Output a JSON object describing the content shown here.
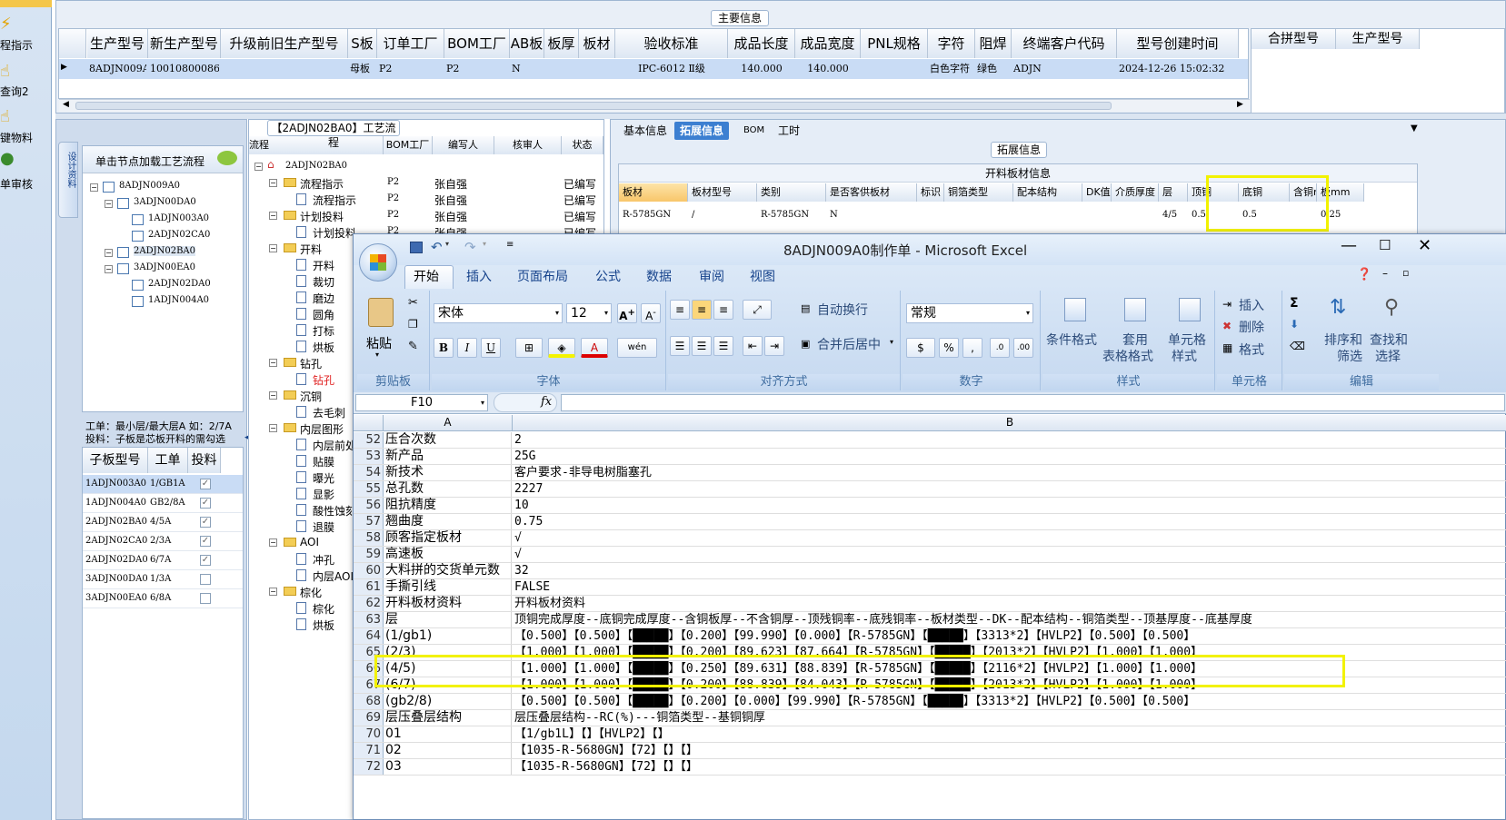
{
  "left_toolbar": {
    "items": [
      "程指示",
      "查询2",
      "键物料",
      "单审核"
    ]
  },
  "main_info": {
    "group_title": "主要信息",
    "headers": [
      "生产型号",
      "新生产型号",
      "升级前旧生产型号",
      "S板",
      "订单工厂",
      "BOM工厂",
      "AB板",
      "板厚",
      "板材",
      "验收标准",
      "成品长度",
      "成品宽度",
      "PNL规格",
      "字符",
      "阻焊",
      "终端客户代码",
      "型号创建时间"
    ],
    "row": [
      "8ADJN009A0",
      "10010800086888",
      "",
      "母板",
      "P2",
      "P2",
      "N",
      "",
      "",
      "IPC-6012 Ⅱ级",
      "140.000",
      "140.000",
      "",
      "白色字符",
      "绿色",
      "ADJN",
      "2024-12-26 15:02:32"
    ],
    "side_headers": [
      "合拼型号",
      "生产型号"
    ]
  },
  "process": {
    "group_title": "【2ADJN02BA0】工艺流程",
    "side_tab": "设计资料",
    "tree_header": "单击节点加载工艺流程",
    "tree": [
      "8ADJN009A0",
      "3ADJN00DA0",
      "1ADJN003A0",
      "2ADJN02CA0",
      "2ADJN02BA0",
      "3ADJN00EA0",
      "2ADJN02DA0",
      "1ADJN004A0"
    ],
    "note1": "工单：最小层/最大层A 如：2/7A",
    "note2": "投料：子板是芯板开料的需勾选",
    "sub_headers": [
      "子板型号",
      "工单",
      "投料"
    ],
    "sub_rows": [
      [
        "1ADJN003A0",
        "1/GB1A",
        true
      ],
      [
        "1ADJN004A0",
        "GB2/8A",
        true
      ],
      [
        "2ADJN02BA0",
        "4/5A",
        true
      ],
      [
        "2ADJN02CA0",
        "2/3A",
        true
      ],
      [
        "2ADJN02DA0",
        "6/7A",
        true
      ],
      [
        "3ADJN00DA0",
        "1/3A",
        false
      ],
      [
        "3ADJN00EA0",
        "6/8A",
        false
      ]
    ],
    "flow_headers": [
      "流程",
      "BOM工厂",
      "编写人",
      "核审人",
      "状态"
    ],
    "flow_root": "2ADJN02BA0",
    "flow_items": [
      {
        "label": "流程指示",
        "level": 1,
        "bom": "P2",
        "author": "张自强",
        "status": "已编写"
      },
      {
        "label": "流程指示",
        "level": 2,
        "bom": "P2",
        "author": "张自强",
        "status": "已编写"
      },
      {
        "label": "计划投料",
        "level": 1,
        "bom": "P2",
        "author": "张自强",
        "status": "已编写"
      },
      {
        "label": "计划投料",
        "level": 2,
        "bom": "P2",
        "author": "张自强",
        "status": "已编写"
      },
      {
        "label": "开料",
        "level": 1
      },
      {
        "label": "开料",
        "level": 2
      },
      {
        "label": "裁切",
        "level": 2
      },
      {
        "label": "磨边",
        "level": 2
      },
      {
        "label": "圆角",
        "level": 2
      },
      {
        "label": "打标",
        "level": 2
      },
      {
        "label": "烘板",
        "level": 2
      },
      {
        "label": "钻孔",
        "level": 1
      },
      {
        "label": "钻孔",
        "level": 2,
        "red": true
      },
      {
        "label": "沉铜",
        "level": 1
      },
      {
        "label": "去毛刺",
        "level": 2
      },
      {
        "label": "内层图形",
        "level": 1
      },
      {
        "label": "内层前处",
        "level": 2
      },
      {
        "label": "贴膜",
        "level": 2
      },
      {
        "label": "曝光",
        "level": 2
      },
      {
        "label": "显影",
        "level": 2
      },
      {
        "label": "酸性蚀刻",
        "level": 2
      },
      {
        "label": "退膜",
        "level": 2
      },
      {
        "label": "AOI",
        "level": 1
      },
      {
        "label": "冲孔",
        "level": 2
      },
      {
        "label": "内层AOI",
        "level": 2
      },
      {
        "label": "棕化",
        "level": 1
      },
      {
        "label": "棕化",
        "level": 2
      },
      {
        "label": "烘板",
        "level": 2
      }
    ]
  },
  "ext_info": {
    "tabs": [
      "基本信息",
      "拓展信息",
      "BOM",
      "工时"
    ],
    "group_title": "拓展信息",
    "table_title": "开料板材信息",
    "headers": [
      "板材",
      "板材型号",
      "类别",
      "是否客供板材",
      "标识",
      "铜箔类型",
      "配本结构",
      "DK值",
      "介质厚度",
      "层",
      "顶铜",
      "底铜",
      "含铜mm",
      "板mm"
    ],
    "row": [
      "R-5785GN",
      "/",
      "R-5785GN",
      "N",
      "",
      "",
      "",
      "",
      "",
      "4/5",
      "0.5",
      "0.5",
      "",
      "0.25"
    ]
  },
  "excel": {
    "title": "8ADJN009A0制作单 - Microsoft Excel",
    "tabs": [
      "开始",
      "插入",
      "页面布局",
      "公式",
      "数据",
      "审阅",
      "视图"
    ],
    "groups": {
      "clipboard": "剪贴板",
      "font": "字体",
      "align": "对齐方式",
      "number": "数字",
      "styles": "样式",
      "cells": "单元格",
      "edit": "编辑"
    },
    "paste": "粘贴",
    "font_name": "宋体",
    "font_size": "12",
    "wrap": "自动换行",
    "merge": "合并后居中",
    "number_format": "常规",
    "cond_fmt": "条件格式",
    "table_fmt_1": "套用",
    "table_fmt_2": "表格格式",
    "cell_style_1": "单元格",
    "cell_style_2": "样式",
    "insert": "插入",
    "delete": "删除",
    "format": "格式",
    "sort_1": "排序和",
    "sort_2": "筛选",
    "find_1": "查找和",
    "find_2": "选择",
    "name_box": "F10",
    "col_a": "A",
    "col_b": "B",
    "rows": [
      [
        "52",
        "压合次数",
        "2"
      ],
      [
        "53",
        "新产品",
        "25G"
      ],
      [
        "54",
        "新技术",
        "客户要求-非导电树脂塞孔"
      ],
      [
        "55",
        "总孔数",
        "2227"
      ],
      [
        "56",
        "阻抗精度",
        "10"
      ],
      [
        "57",
        "翘曲度",
        "0.75"
      ],
      [
        "58",
        "顾客指定板材",
        "√"
      ],
      [
        "59",
        "高速板",
        "√"
      ],
      [
        "60",
        "大料拼的交货单元数",
        "32"
      ],
      [
        "61",
        "手撕引线",
        "FALSE"
      ],
      [
        "62",
        "开料板材资料",
        "开料板材资料"
      ],
      [
        "63",
        "层",
        "顶铜完成厚度--底铜完成厚度--含铜板厚--不含铜厚--顶残铜率--底残铜率--板材类型--DK--配本结构--铜箔类型--顶基厚度--底基厚度"
      ],
      [
        "64",
        "(1/gb1)",
        "【0.500】【0.500】【█████】【0.200】【99.990】【0.000】【R-5785GN】【█████】【3313*2】【HVLP2】【0.500】【0.500】"
      ],
      [
        "65",
        "(2/3)",
        "【1.000】【1.000】【█████】【0.200】【89.623】【87.664】【R-5785GN】【█████】【2013*2】【HVLP2】【1.000】【1.000】"
      ],
      [
        "66",
        "(4/5)",
        "【1.000】【1.000】【█████】【0.250】【89.631】【88.839】【R-5785GN】【█████】【2116*2】【HVLP2】【1.000】【1.000】"
      ],
      [
        "67",
        "(6/7)",
        "【1.000】【1.000】【█████】【0.200】【88.839】【84.043】【R-5785GN】【█████】【2013*2】【HVLP2】【1.000】【1.000】"
      ],
      [
        "68",
        "(gb2/8)",
        "【0.500】【0.500】【█████】【0.200】【0.000】【99.990】【R-5785GN】【█████】【3313*2】【HVLP2】【0.500】【0.500】"
      ],
      [
        "69",
        "层压叠层结构",
        "层压叠层结构--RC(%)---铜箔类型--基铜铜厚"
      ],
      [
        "70",
        "01",
        "【1/gb1L】【】【HVLP2】【】"
      ],
      [
        "71",
        "02",
        "【1035-R-5680GN】【72】【】【】"
      ],
      [
        "72",
        "03",
        "【1035-R-5680GN】【72】【】【】"
      ]
    ]
  }
}
